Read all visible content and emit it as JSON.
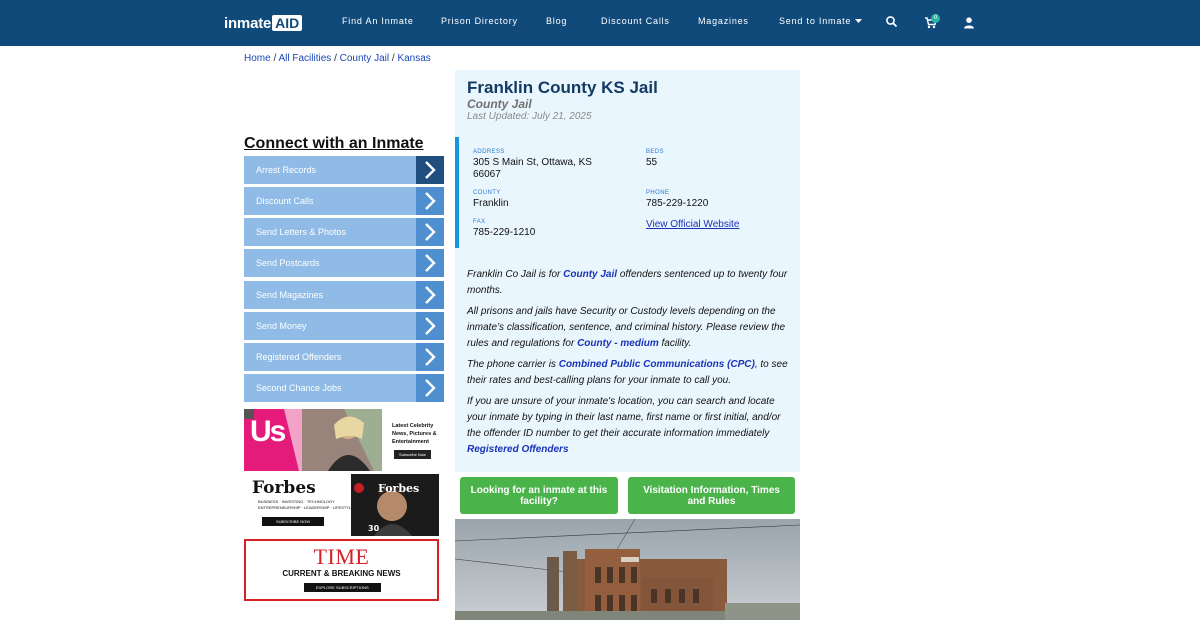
{
  "nav": {
    "logo_text": "inmate",
    "logo_box": "AID",
    "links": [
      "Find An Inmate",
      "Prison Directory",
      "Blog",
      "Discount Calls",
      "Magazines",
      "Send to Inmate"
    ],
    "cart_count": "0",
    "icons": [
      "search-icon",
      "cart-icon",
      "user-icon",
      "caret-down-icon"
    ]
  },
  "breadcrumb": {
    "home": "Home",
    "all_facilities": "All Facilities",
    "county_jail": "County Jail",
    "state": "Kansas",
    "separator": "/"
  },
  "sidebar": {
    "title": "Connect with an Inmate",
    "items": [
      "Arrest Records",
      "Discount Calls",
      "Send Letters & Photos",
      "Send Postcards",
      "Send Magazines",
      "Send Money",
      "Registered Offenders",
      "Second Chance Jobs"
    ]
  },
  "ads": {
    "us": {
      "logo": "Us",
      "line1": "Latest Celebrity",
      "line2": "News, Pictures &",
      "line3": "Entertainment",
      "cta": "Subscribe Now"
    },
    "forbes": {
      "logo": "Forbes",
      "line1": "BUSINESS · INVESTING · TECHNOLOGY",
      "line2": "ENTREPRENEURSHIP · LEADERSHIP · LIFESTYLE",
      "cta": "SUBSCRIBE NOW",
      "cover_logo": "Forbes",
      "cover_num": "30"
    },
    "time": {
      "logo": "TIME",
      "line1": "CURRENT & BREAKING NEWS",
      "cta": "EXPLORE SUBSCRIPTIONS"
    }
  },
  "facility": {
    "title": "Franklin County KS Jail",
    "type": "County Jail",
    "updated": "Last Updated: July 21, 2025",
    "address_label": "ADDRESS",
    "address_line1": "305 S Main St, Ottawa, KS",
    "address_line2": "66067",
    "beds_label": "BEDS",
    "beds": "55",
    "county_label": "COUNTY",
    "county": "Franklin",
    "phone_label": "PHONE",
    "phone": "785-229-1220",
    "fax_label": "FAX",
    "fax": "785-229-1210",
    "website_link": "View Official Website"
  },
  "description": {
    "p1_a": "Franklin Co Jail is for ",
    "p1_link": "County Jail",
    "p1_b": " offenders sentenced up to twenty four months.",
    "p2_a": "All prisons and jails have Security or Custody levels depending on the inmate’s classification, sentence, and criminal history. Please review the rules and regulations for ",
    "p2_link": "County - medium",
    "p2_b": " facility.",
    "p3_a": "The phone carrier is ",
    "p3_link": "Combined Public Communications (CPC)",
    "p3_b": ", to see their rates and best-calling plans for your inmate to call you.",
    "p4_a": "If you are unsure of your inmate's location, you can search and locate your inmate by typing in their last name, first name or first initial, and/or the offender ID number to get their accurate information immediately ",
    "p4_link": "Registered Offenders"
  },
  "buttons": {
    "looking": "Looking for an inmate at this facility?",
    "visitation": "Visitation Information, Times and Rules"
  },
  "colors": {
    "nav_bg": "#0f4a7b",
    "card_bg": "#eaf6fd",
    "green": "#4ab34a",
    "link": "#1a33b8",
    "sidebar_btn": "#8fbbe6"
  }
}
